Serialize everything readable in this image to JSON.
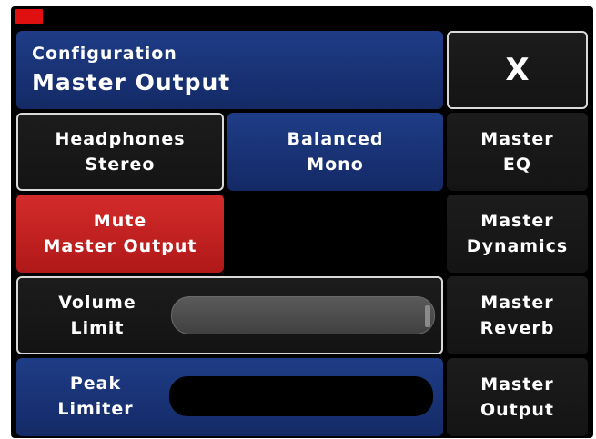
{
  "header": {
    "subtitle": "Configuration",
    "title": "Master Output",
    "close_label": "X"
  },
  "output_mode": {
    "headphones": [
      "Headphones",
      "Stereo"
    ],
    "balanced": [
      "Balanced",
      "Mono"
    ]
  },
  "mute": [
    "Mute",
    "Master Output"
  ],
  "volume_limit": {
    "label": [
      "Volume",
      "Limit"
    ],
    "value": 1.0
  },
  "peak_limiter": {
    "label": [
      "Peak",
      "Limiter"
    ]
  },
  "side_nav": [
    [
      "Master",
      "EQ"
    ],
    [
      "Master",
      "Dynamics"
    ],
    [
      "Master",
      "Reverb"
    ],
    [
      "Master",
      "Output"
    ]
  ],
  "colors": {
    "accent_blue": "#1e3c86",
    "mute_red": "#d42b2b",
    "indicator_red": "#e01010"
  }
}
